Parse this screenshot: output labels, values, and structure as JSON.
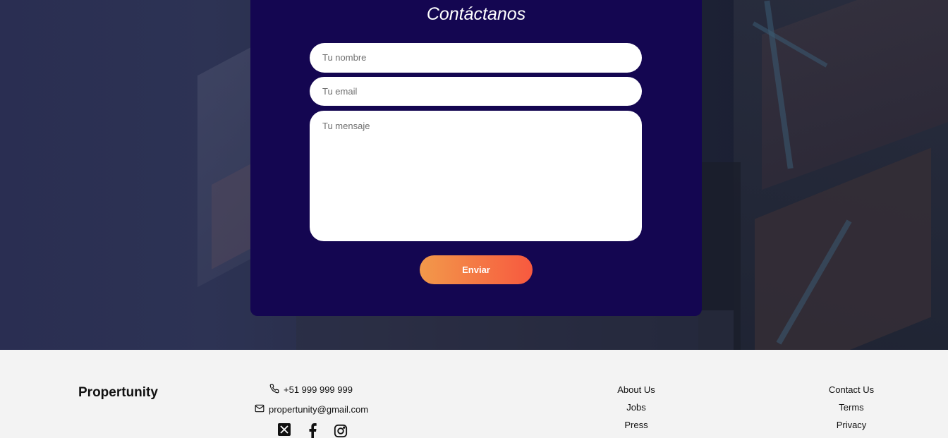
{
  "contact": {
    "title": "Contáctanos",
    "name_placeholder": "Tu nombre",
    "email_placeholder": "Tu email",
    "message_placeholder": "Tu mensaje",
    "submit_label": "Enviar"
  },
  "footer": {
    "brand": "Propertunity",
    "phone": "+51 999 999 999",
    "email": "propertunity@gmail.com",
    "socials": [
      "x-icon",
      "facebook-icon",
      "instagram-icon"
    ],
    "links_col1": [
      "About Us",
      "Jobs",
      "Press"
    ],
    "links_col2": [
      "Contact Us",
      "Terms",
      "Privacy"
    ]
  },
  "colors": {
    "card_bg": "#140651",
    "button_gradient_start": "#f2994a",
    "button_gradient_end": "#f7593f",
    "footer_bg": "#f3f3f3"
  }
}
